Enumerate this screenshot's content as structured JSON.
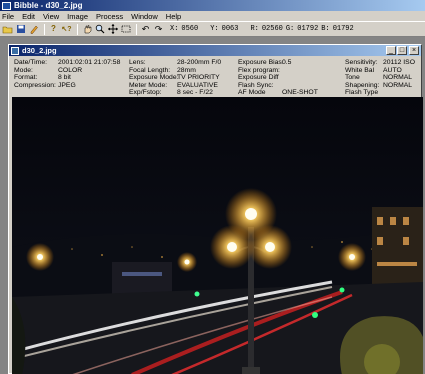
{
  "app": {
    "title": "Bibble - d30_2.jpg"
  },
  "menu": [
    "File",
    "Edit",
    "View",
    "Image",
    "Process",
    "Window",
    "Help"
  ],
  "toolbar": {
    "icons": [
      "open-folder-icon",
      "save-icon",
      "pencil-icon",
      "help-icon",
      "help-pointer-icon",
      "pan-hand-icon",
      "zoom-magnifier-icon",
      "crosshair-icon",
      "marquee-select-icon",
      "rotate-left-icon",
      "rotate-right-icon"
    ],
    "readout": {
      "x_label": "X:",
      "x_value": "0560",
      "y_label": "Y:",
      "y_value": "0063",
      "r_label": "R:",
      "r_value": "02560",
      "g_label": "G:",
      "g_value": "01792",
      "b_label": "B:",
      "b_value": "01792"
    }
  },
  "document": {
    "title": "d30_2.jpg",
    "window_buttons": [
      "minimize",
      "maximize",
      "close"
    ],
    "exif": {
      "col1": [
        {
          "label": "Date/Time:",
          "value": "2001:02:01 21:07:58"
        },
        {
          "label": "Mode:",
          "value": "COLOR"
        },
        {
          "label": "Format:",
          "value": "8 bit"
        },
        {
          "label": "Compression:",
          "value": "JPEG"
        }
      ],
      "col2": [
        {
          "label": "Lens:",
          "value": "28-200mm F/0"
        },
        {
          "label": "Focal Length:",
          "value": "28mm"
        },
        {
          "label": "Exposure Mode:",
          "value": "TV PRIORITY"
        },
        {
          "label": "Meter Mode:",
          "value": "EVALUATIVE"
        },
        {
          "label": "Exp/Fstop:",
          "value": "8 sec - F/22"
        }
      ],
      "col3": [
        {
          "label": "Exposure Bias:",
          "value": "0.5"
        },
        {
          "label": "Flex program:",
          "value": ""
        },
        {
          "label": "Exposure Diff",
          "value": ""
        },
        {
          "label": "Flash Sync:",
          "value": ""
        },
        {
          "label": "AF Mode",
          "value": "ONE-SHOT"
        }
      ],
      "col4": [
        {
          "label": "Sensitivity:",
          "value": "20112 ISO"
        },
        {
          "label": "White Bal",
          "value": "AUTO"
        },
        {
          "label": "Tone",
          "value": "NORMAL"
        },
        {
          "label": "Shapening:",
          "value": "NORMAL"
        },
        {
          "label": "Flash Type",
          "value": ""
        }
      ]
    }
  },
  "colors": {
    "titlebar": "#0a246a",
    "chrome": "#d4d0c8",
    "workspace": "#848484"
  }
}
